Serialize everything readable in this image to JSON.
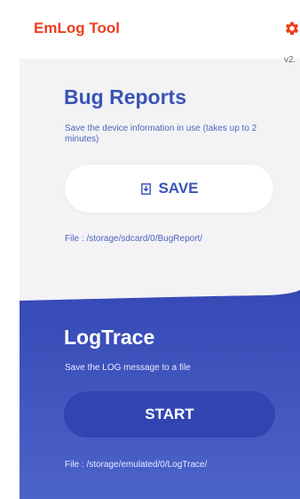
{
  "app": {
    "title": "EmLog Tool",
    "version": "v2.",
    "accent_color": "#ee3e1d",
    "settings_icon": "gear-icon"
  },
  "bug_reports": {
    "title": "Bug Reports",
    "description": "Save the device information in use (takes up to 2 minutes)",
    "button_label": "SAVE",
    "button_icon": "save-icon",
    "file_path": "File : /storage/sdcard/0/BugReport/",
    "color": "#3a54b6"
  },
  "log_trace": {
    "title": "LogTrace",
    "description": "Save the LOG message to a file",
    "button_label": "START",
    "file_path": "File : /storage/emulated/0/LogTrace/",
    "background_color": "#4257c0",
    "button_color": "#3145b2"
  }
}
